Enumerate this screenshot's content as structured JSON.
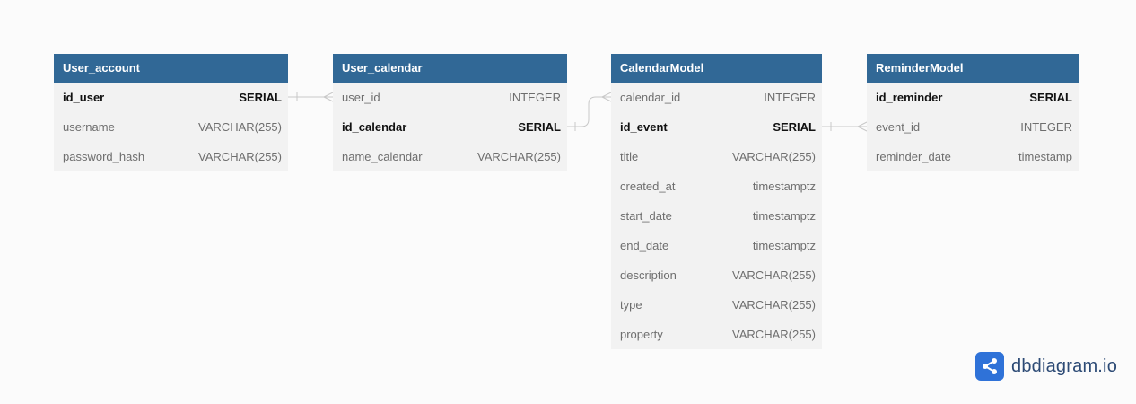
{
  "tables": [
    {
      "name": "User_account",
      "fields": [
        {
          "name": "id_user",
          "type": "SERIAL",
          "pk": true
        },
        {
          "name": "username",
          "type": "VARCHAR(255)",
          "pk": false
        },
        {
          "name": "password_hash",
          "type": "VARCHAR(255)",
          "pk": false
        }
      ]
    },
    {
      "name": "User_calendar",
      "fields": [
        {
          "name": "user_id",
          "type": "INTEGER",
          "pk": false
        },
        {
          "name": "id_calendar",
          "type": "SERIAL",
          "pk": true
        },
        {
          "name": "name_calendar",
          "type": "VARCHAR(255)",
          "pk": false
        }
      ]
    },
    {
      "name": "CalendarModel",
      "fields": [
        {
          "name": "calendar_id",
          "type": "INTEGER",
          "pk": false
        },
        {
          "name": "id_event",
          "type": "SERIAL",
          "pk": true
        },
        {
          "name": "title",
          "type": "VARCHAR(255)",
          "pk": false
        },
        {
          "name": "created_at",
          "type": "timestamptz",
          "pk": false
        },
        {
          "name": "start_date",
          "type": "timestamptz",
          "pk": false
        },
        {
          "name": "end_date",
          "type": "timestamptz",
          "pk": false
        },
        {
          "name": "description",
          "type": "VARCHAR(255)",
          "pk": false
        },
        {
          "name": "type",
          "type": "VARCHAR(255)",
          "pk": false
        },
        {
          "name": "property",
          "type": "VARCHAR(255)",
          "pk": false
        }
      ]
    },
    {
      "name": "ReminderModel",
      "fields": [
        {
          "name": "id_reminder",
          "type": "SERIAL",
          "pk": true
        },
        {
          "name": "event_id",
          "type": "INTEGER",
          "pk": false
        },
        {
          "name": "reminder_date",
          "type": "timestamp",
          "pk": false
        }
      ]
    }
  ],
  "relationships": [
    {
      "from": "User_account.id_user",
      "to": "User_calendar.user_id",
      "kind": "one-to-many"
    },
    {
      "from": "User_calendar.id_calendar",
      "to": "CalendarModel.calendar_id",
      "kind": "one-to-many"
    },
    {
      "from": "CalendarModel.id_event",
      "to": "ReminderModel.event_id",
      "kind": "one-to-many"
    }
  ],
  "brand": {
    "text": "dbdiagram.io",
    "icon": "share-nodes-icon"
  },
  "colors": {
    "header": "#316896",
    "body": "#f2f2f2",
    "edge": "#c8c8c8",
    "brand": "#2f72d8"
  }
}
